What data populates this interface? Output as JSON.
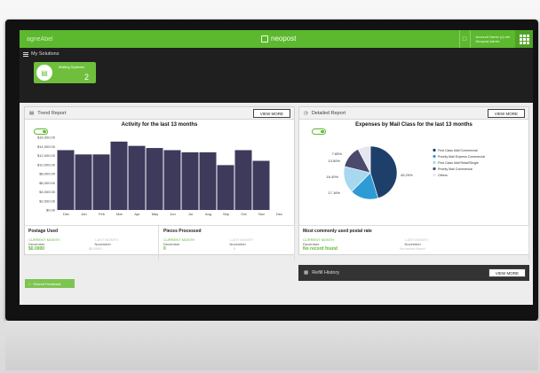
{
  "header": {
    "app_name": "agneAbel",
    "brand": "neopost",
    "account_line1": "Account Name (o) sel",
    "account_line2": "Neopost Admin"
  },
  "solutions": {
    "title": "My Solutions",
    "tile": {
      "label": "Mailing Systems",
      "count": "2"
    }
  },
  "trend": {
    "title": "Trend Report",
    "view_more": "VIEW MORE",
    "chart_title": "Activity for the last 13 months"
  },
  "detailed": {
    "title": "Detailed Report",
    "view_more": "VIEW MORE",
    "chart_title": "Expenses by Mail Class for the last 13 months"
  },
  "stats": {
    "postage": {
      "title": "Postage Used",
      "sub": "CURRENT MONTH",
      "sub2": "LAST MONTH",
      "label1": "December",
      "label2": "November",
      "val1": "$0.0000",
      "val2": "$0.0000"
    },
    "pieces": {
      "title": "Pieces Processed",
      "sub": "CURRENT MONTH",
      "sub2": "LAST MONTH",
      "label1": "December",
      "label2": "November",
      "val1": "0",
      "val2": "0"
    },
    "postal_rate": {
      "title": "Most commonly used postal rate",
      "sub": "CURRENT MONTH",
      "sub2": "LAST MONTH",
      "label1": "December",
      "label2": "November",
      "val1": "No record found",
      "val2": "No record found"
    }
  },
  "refill": {
    "title": "Refill History",
    "view_more": "VIEW MORE"
  },
  "feedback": {
    "label": "Submit Feedback"
  },
  "chart_data": [
    {
      "type": "bar",
      "title": "Activity for the last 13 months",
      "categories": [
        "Dec",
        "Jan",
        "Feb",
        "Mar",
        "Apr",
        "May",
        "Jun",
        "Jul",
        "Aug",
        "Sep",
        "Oct",
        "Nov",
        "Dec"
      ],
      "values": [
        14000,
        13000,
        13000,
        16000,
        15000,
        14500,
        14000,
        13500,
        13500,
        10500,
        14000,
        11500,
        0
      ],
      "yticks": [
        "$16,000.00",
        "$14,000.00",
        "$12,000.00",
        "$10,000.00",
        "$8,000.00",
        "$6,000.00",
        "$4,000.00",
        "$2,000.00",
        "$0.00"
      ],
      "ylim": [
        0,
        17000
      ],
      "color": "#3d3a5c"
    },
    {
      "type": "pie",
      "title": "Expenses by Mail Class for the last 13 months",
      "slices": [
        {
          "label": "First Class Mail Commercial",
          "value": 45.29,
          "color": "#1f3f6b"
        },
        {
          "label": "Priority Mail Express Commercial",
          "value": 17.16,
          "color": "#2e9bd6"
        },
        {
          "label": "First Class Mail Retail/Single",
          "value": 16.4,
          "color": "#a8d8f0"
        },
        {
          "label": "Priority Mail Commercial",
          "value": 13.5,
          "color": "#4a4a6b"
        },
        {
          "label": "Others",
          "value": 7.65,
          "color": "#e6e6f0"
        }
      ],
      "labels": [
        "45.29%",
        "16.40%",
        "17.16%",
        "7.65%",
        "13.50%"
      ]
    }
  ]
}
